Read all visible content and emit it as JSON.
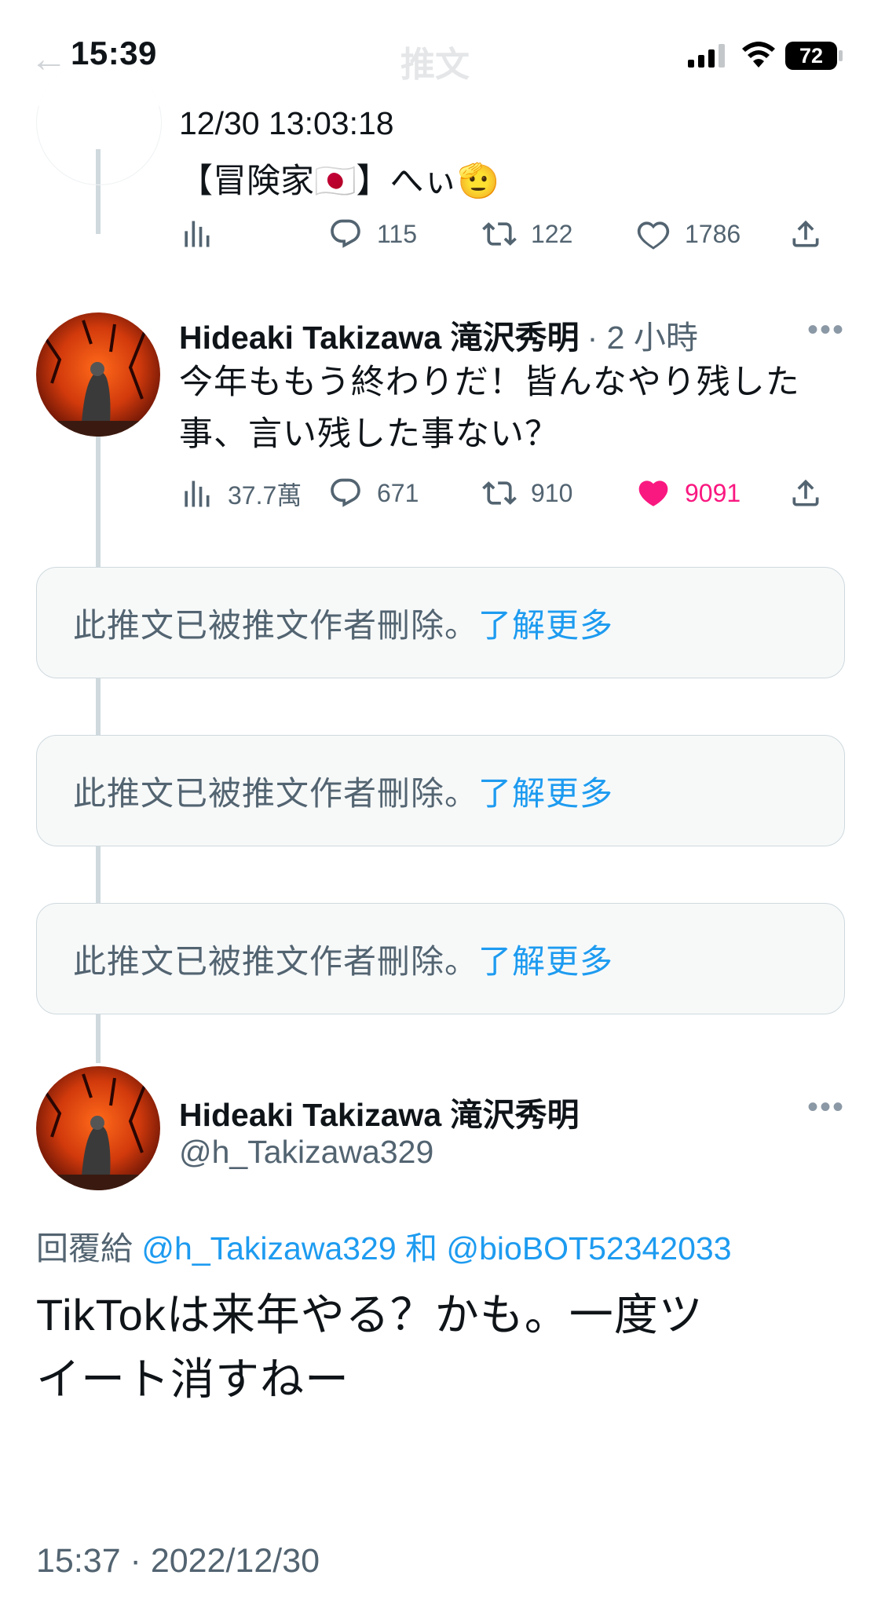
{
  "status_bar": {
    "time": "15:39",
    "battery": "72"
  },
  "nav": {
    "back_glyph": "←",
    "title": "推文"
  },
  "tweet_prev": {
    "date_line": "12/30 13:03:18",
    "text": "【冒険家🇯🇵】へぃ🫡",
    "views": "",
    "replies": "115",
    "retweets": "122",
    "likes": "1786"
  },
  "tweet_mid": {
    "name": "Hideaki Takizawa 滝沢秀明",
    "time": "· 2 小時",
    "text_line1": "今年ももう終わりだ！皆んなやり残した",
    "text_line2": "事、言い残した事ない？",
    "views": "37.7萬",
    "replies": "671",
    "retweets": "910",
    "likes": "9091",
    "liked": true
  },
  "deleted": [
    {
      "text": "此推文已被推文作者刪除。",
      "link": "了解更多"
    },
    {
      "text": "此推文已被推文作者刪除。",
      "link": "了解更多"
    },
    {
      "text": "此推文已被推文作者刪除。",
      "link": "了解更多"
    }
  ],
  "main_tweet": {
    "name": "Hideaki Takizawa 滝沢秀明",
    "handle": "@h_Takizawa329",
    "reply_prefix": "回覆給",
    "reply_user1": "@h_Takizawa329",
    "reply_and": "和",
    "reply_user2": "@bioBOT52342033",
    "text_line1": "TikTokは来年やる？かも。一度ツ",
    "text_line2": "イート消すねー",
    "timestamp": "15:37 · 2022/12/30"
  },
  "colors": {
    "accent": "#1d9bf0",
    "like": "#f91880",
    "muted": "#536471",
    "line": "#cfd9de"
  },
  "icons": [
    "views-icon",
    "reply-icon",
    "retweet-icon",
    "like-icon",
    "share-icon",
    "more-icon",
    "signal-icon",
    "wifi-icon",
    "battery-icon"
  ]
}
